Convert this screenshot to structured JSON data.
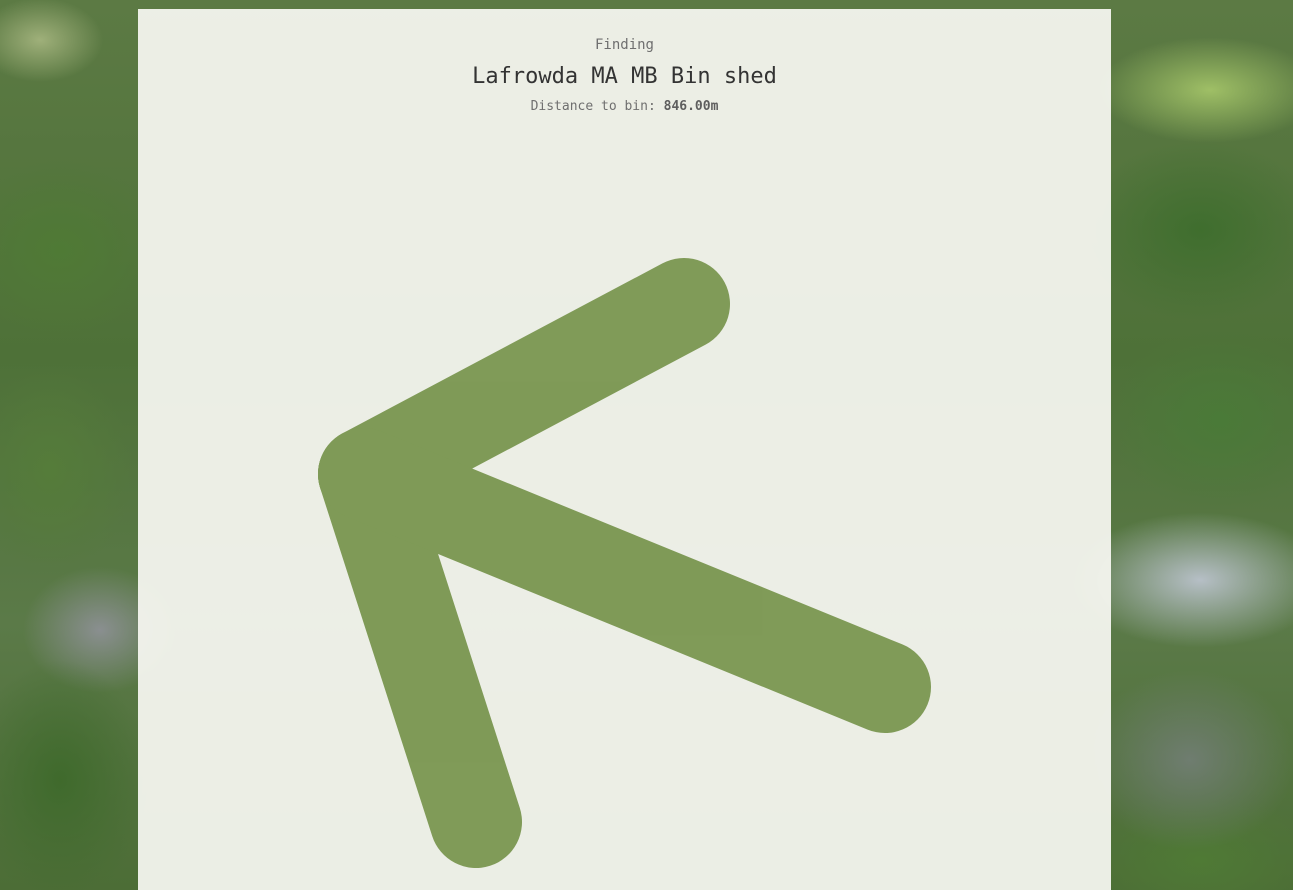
{
  "header": {
    "finding_label": "Finding",
    "target_name": "Lafrowda MA MB Bin shed",
    "distance_label": "Distance to bin:",
    "distance_value": "846.00m"
  },
  "arrow": {
    "icon": "direction-arrow-icon",
    "color": "#7a9650"
  },
  "colors": {
    "panel": "#f7f7f2",
    "accent": "#7a9650"
  }
}
